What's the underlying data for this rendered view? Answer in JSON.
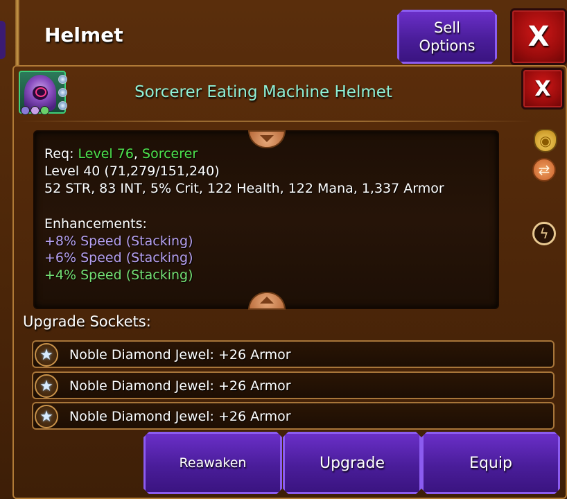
{
  "header": {
    "title": "Helmet",
    "sell_options_label": "Sell\nOptions",
    "close_label": "X"
  },
  "item": {
    "name": "Sorcerer Eating Machine Helmet",
    "close_label": "X",
    "portrait_icon": "sorcerer-helmet-icon",
    "socket_pips": [
      "star-icon",
      "star-icon",
      "star-icon"
    ],
    "dot_colors": [
      "#8a7ad8",
      "#c8a0e8",
      "#6ad06a"
    ]
  },
  "details": {
    "req_prefix": "Req: ",
    "req_level": "Level 76",
    "req_sep": ", ",
    "req_class": "Sorcerer",
    "level_line": "Level 40 (71,279/151,240)",
    "stats_line": "52 STR, 83 INT, 5% Crit, 122 Health, 122 Mana, 1,337 Armor",
    "enhancements_label": "Enhancements:",
    "enhancements": [
      "+8% Speed (Stacking)",
      "+6% Speed (Stacking)",
      "+4% Speed (Stacking)"
    ]
  },
  "side_icons": [
    "gold-bag-icon",
    "swap-icon",
    "lightning-icon"
  ],
  "sockets": {
    "label": "Upgrade Sockets:",
    "items": [
      "Noble Diamond Jewel: +26 Armor",
      "Noble Diamond Jewel: +26 Armor",
      "Noble Diamond Jewel: +26 Armor"
    ]
  },
  "actions": {
    "reawaken": "Reawaken",
    "upgrade": "Upgrade",
    "equip": "Equip"
  },
  "colors": {
    "accent_purple": "#6a2fc8",
    "close_red": "#d01818",
    "title_teal": "#8ff0d6",
    "req_green": "#4ee44e",
    "enh_lavender": "#b6a0f0",
    "enh_green": "#74e074"
  }
}
